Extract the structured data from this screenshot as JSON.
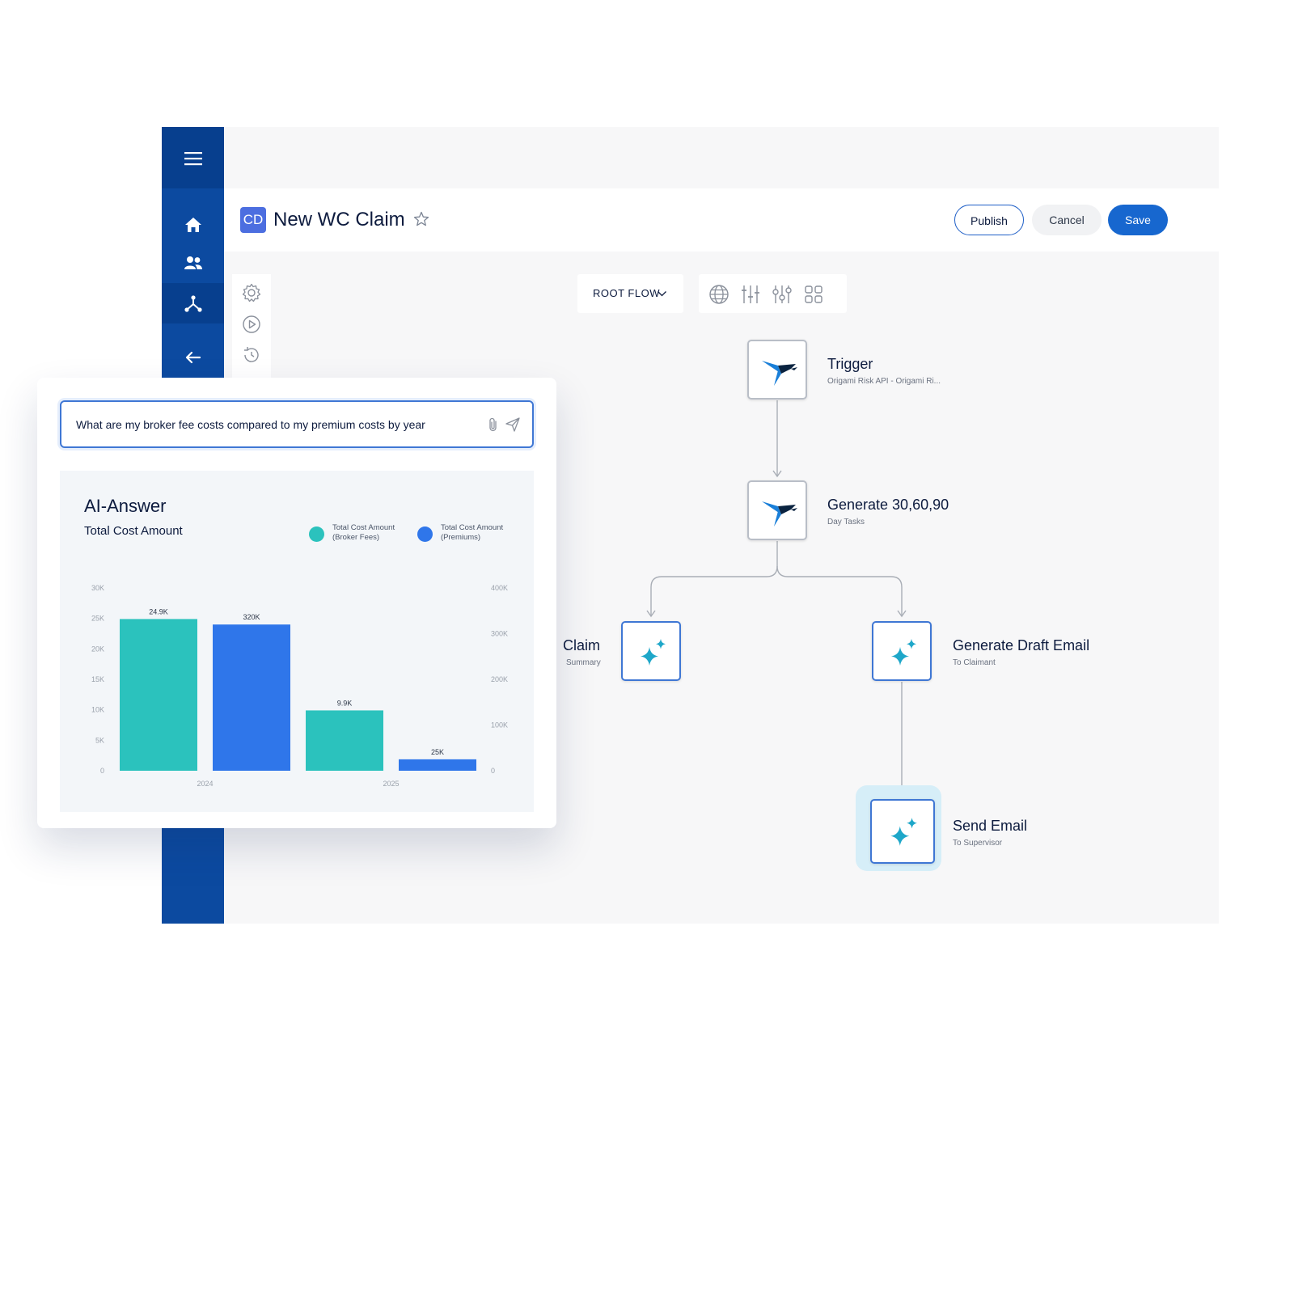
{
  "header": {
    "badge": "CD",
    "title": "New WC Claim",
    "publish_label": "Publish",
    "cancel_label": "Cancel",
    "save_label": "Save"
  },
  "sidebar": {
    "items": [
      {
        "icon": "menu-icon"
      },
      {
        "icon": "home-icon"
      },
      {
        "icon": "users-icon"
      },
      {
        "icon": "flow-icon",
        "active": true
      },
      {
        "icon": "back-arrow-icon"
      }
    ]
  },
  "toolbar": {
    "root_flow_label": "ROOT FLOW",
    "icons": [
      "globe-icon",
      "sliders-icon",
      "adjust-icon",
      "grid-icon"
    ]
  },
  "tools": [
    "settings-icon",
    "play-icon",
    "history-icon"
  ],
  "flow": {
    "nodes": [
      {
        "title": "Trigger",
        "subtitle": "Origami Risk API - Origami Ri...",
        "icon": "origami-bird-icon"
      },
      {
        "title": "Generate 30,60,90",
        "subtitle": "Day Tasks",
        "icon": "origami-bird-icon"
      },
      {
        "title": "Claim",
        "subtitle": "Summary",
        "icon": "ai-sparkle-icon"
      },
      {
        "title": "Generate Draft Email",
        "subtitle": "To Claimant",
        "icon": "ai-sparkle-icon"
      },
      {
        "title": "Send Email",
        "subtitle": "To Supervisor",
        "icon": "ai-sparkle-icon"
      }
    ]
  },
  "ai_panel": {
    "query": "What are my broker fee costs compared to my premium costs by year",
    "answer_title": "AI-Answer",
    "answer_subtitle": "Total Cost Amount",
    "legend": [
      {
        "label_line1": "Total Cost Amount",
        "label_line2": "(Broker Fees)",
        "color": "#2bc2bd"
      },
      {
        "label_line1": "Total Cost Amount",
        "label_line2": "(Premiums)",
        "color": "#2f76ea"
      }
    ]
  },
  "chart_data": {
    "type": "bar",
    "categories": [
      "2024",
      "2025"
    ],
    "series": [
      {
        "name": "Total Cost Amount (Broker Fees)",
        "axis": "left",
        "values": [
          24900,
          9900
        ],
        "labels": [
          "24.9K",
          "9.9K"
        ],
        "color": "#2bc2bd"
      },
      {
        "name": "Total Cost Amount (Premiums)",
        "axis": "right",
        "values": [
          320000,
          25000
        ],
        "labels": [
          "320K",
          "25K"
        ],
        "color": "#2f76ea"
      }
    ],
    "left_axis": {
      "ylim": [
        0,
        30000
      ],
      "ticks": [
        "0",
        "5K",
        "10K",
        "15K",
        "20K",
        "25K",
        "30K"
      ]
    },
    "right_axis": {
      "ylim": [
        0,
        400000
      ],
      "ticks": [
        "0",
        "100K",
        "200K",
        "300K",
        "400K"
      ]
    },
    "title": "AI-Answer",
    "subtitle": "Total Cost Amount"
  }
}
